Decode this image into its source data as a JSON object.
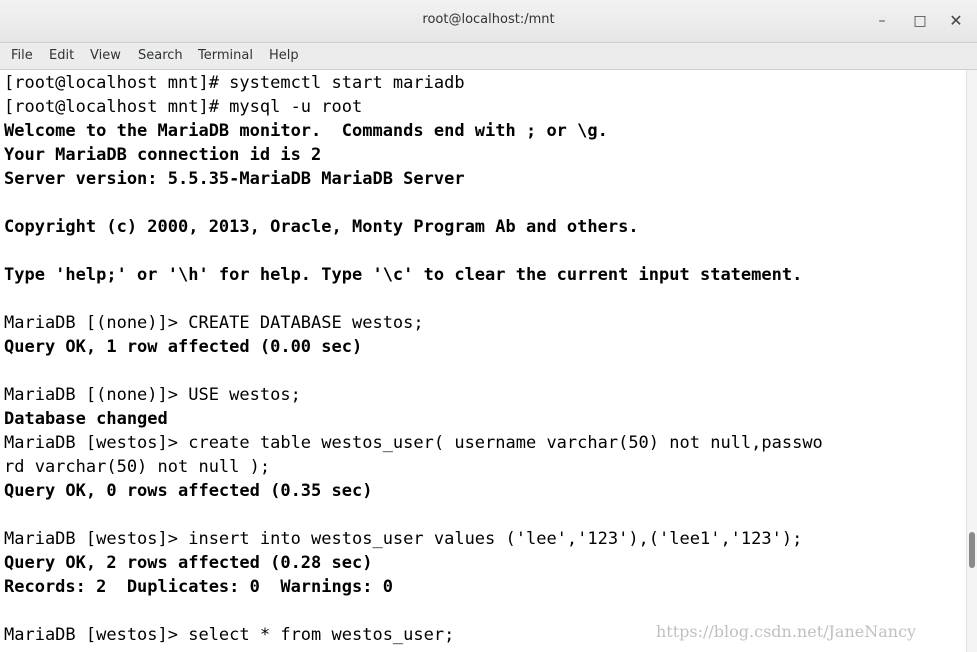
{
  "window": {
    "title": "root@localhost:/mnt",
    "minimize_icon": "minimize-icon",
    "maximize_icon": "maximize-icon",
    "close_icon": "close-icon"
  },
  "menu": [
    "File",
    "Edit",
    "View",
    "Search",
    "Terminal",
    "Help"
  ],
  "terminal": {
    "lines": [
      {
        "text": "[root@localhost mnt]# systemctl start mariadb",
        "bold": false
      },
      {
        "text": "[root@localhost mnt]# mysql -u root",
        "bold": false
      },
      {
        "text": "Welcome to the MariaDB monitor.  Commands end with ; or \\g.",
        "bold": true
      },
      {
        "text": "Your MariaDB connection id is 2",
        "bold": true
      },
      {
        "text": "Server version: 5.5.35-MariaDB MariaDB Server",
        "bold": true
      },
      {
        "text": "",
        "bold": false
      },
      {
        "text": "Copyright (c) 2000, 2013, Oracle, Monty Program Ab and others.",
        "bold": true
      },
      {
        "text": "",
        "bold": false
      },
      {
        "text": "Type 'help;' or '\\h' for help. Type '\\c' to clear the current input statement.",
        "bold": true
      },
      {
        "text": "",
        "bold": false
      },
      {
        "text": "MariaDB [(none)]> CREATE DATABASE westos;",
        "bold": false
      },
      {
        "text": "Query OK, 1 row affected (0.00 sec)",
        "bold": true
      },
      {
        "text": "",
        "bold": false
      },
      {
        "text": "MariaDB [(none)]> USE westos;",
        "bold": false
      },
      {
        "text": "Database changed",
        "bold": true
      },
      {
        "text": "MariaDB [westos]> create table westos_user( username varchar(50) not null,passwo",
        "bold": false
      },
      {
        "text": "rd varchar(50) not null );",
        "bold": false
      },
      {
        "text": "Query OK, 0 rows affected (0.35 sec)",
        "bold": true
      },
      {
        "text": "",
        "bold": false
      },
      {
        "text": "MariaDB [westos]> insert into westos_user values ('lee','123'),('lee1','123');",
        "bold": false
      },
      {
        "text": "Query OK, 2 rows affected (0.28 sec)",
        "bold": true
      },
      {
        "text": "Records: 2  Duplicates: 0  Warnings: 0",
        "bold": true
      },
      {
        "text": "",
        "bold": false
      },
      {
        "text": "MariaDB [westos]> select * from westos_user;",
        "bold": false
      }
    ]
  },
  "watermark": "https://blog.csdn.net/JaneNancy"
}
